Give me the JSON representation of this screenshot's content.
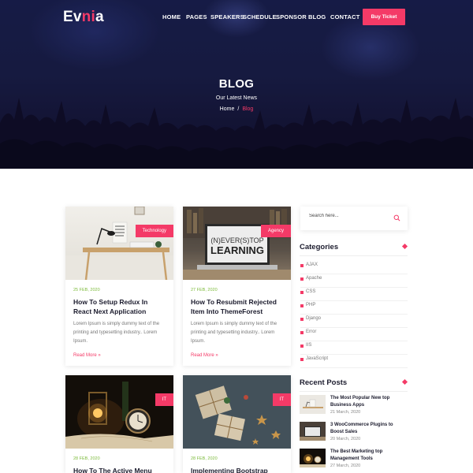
{
  "brand": {
    "name_start": "Ev",
    "name_accent": "ni",
    "name_end": "a"
  },
  "nav": {
    "home": "HOME",
    "pages": "PAGES",
    "speakers": "SPEAKERS",
    "schedule": "SCHEDULE",
    "sponsor": "SPONSOR",
    "blog": "BLOG",
    "contact": "CONTACT",
    "buy_ticket": "Buy Ticket"
  },
  "hero": {
    "title": "BLOG",
    "subtitle": "Our Latest News",
    "breadcrumb": {
      "home": "Home",
      "separator": "/",
      "current": "Blog"
    }
  },
  "posts": [
    {
      "badge": "Technology",
      "date": "25 FEB, 2020",
      "title": "How To Setup Redux In React Next Application",
      "excerpt": "Lorem Ipsum is simply dummy text of the printing and typesetting industry.. Lorem Ipsum.",
      "read_more": "Read More »"
    },
    {
      "badge": "Agency",
      "date": "27 FEB, 2020",
      "title": "How To Resubmit Rejected Item Into ThemeForest",
      "excerpt": "Lorem Ipsum is simply dummy text of the printing and typesetting industry.. Lorem Ipsum.",
      "read_more": "Read More »"
    },
    {
      "badge": "IT",
      "date": "28 FEB, 2020",
      "title": "How To The Active Menu",
      "excerpt": "",
      "read_more": ""
    },
    {
      "badge": "IT",
      "date": "28 FEB, 2020",
      "title": "Implementing Bootstrap",
      "excerpt": "",
      "read_more": ""
    }
  ],
  "sidebar": {
    "search_placeholder": "Search here...",
    "categories_title": "Categories",
    "categories": [
      "AJAX",
      "Apache",
      "CSS",
      "PHP",
      "Django",
      "Error",
      "IIS",
      "JavaScript"
    ],
    "recent_title": "Recent Posts",
    "recent_posts": [
      {
        "title": "The Most Popular New top Business Apps",
        "date": "21 March, 2020"
      },
      {
        "title": "3 WooCommerce Plugins to Boost Sales",
        "date": "20 March, 2020"
      },
      {
        "title": "The Best Marketing top Management Tools",
        "date": "27 March, 2020"
      }
    ]
  },
  "colors": {
    "accent": "#f43a67",
    "date_green": "#7dbb3c",
    "hero_bg": "#1a2150"
  },
  "icons": {
    "search": "search-icon",
    "diamond": "diamond-icon"
  }
}
